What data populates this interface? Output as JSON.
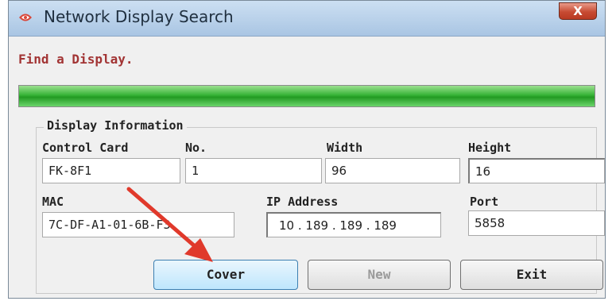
{
  "window": {
    "title": "Network Display Search",
    "close_glyph": "X",
    "accent_color": "#c74b33"
  },
  "status": {
    "message": "Find a Display.",
    "message_color": "#a23434",
    "progress_fraction": 1.0,
    "progress_color": "#37b437"
  },
  "display_info": {
    "group_title": "Display Information",
    "control_card": {
      "label": "Control Card",
      "value": "FK-8F1"
    },
    "no": {
      "label": "No.",
      "value": "1"
    },
    "width": {
      "label": "Width",
      "value": "96"
    },
    "height": {
      "label": "Height",
      "value": "16"
    },
    "mac": {
      "label": "MAC",
      "value": "7C-DF-A1-01-6B-F3"
    },
    "ip_address": {
      "label": "IP Address",
      "octets": [
        "10",
        "189",
        "189",
        "189"
      ]
    },
    "port": {
      "label": "Port",
      "value": "5858"
    }
  },
  "buttons": {
    "cover": "Cover",
    "new": "New",
    "exit": "Exit"
  },
  "annotation": {
    "arrow_color": "#e0392b",
    "points_to": "cover-button"
  }
}
